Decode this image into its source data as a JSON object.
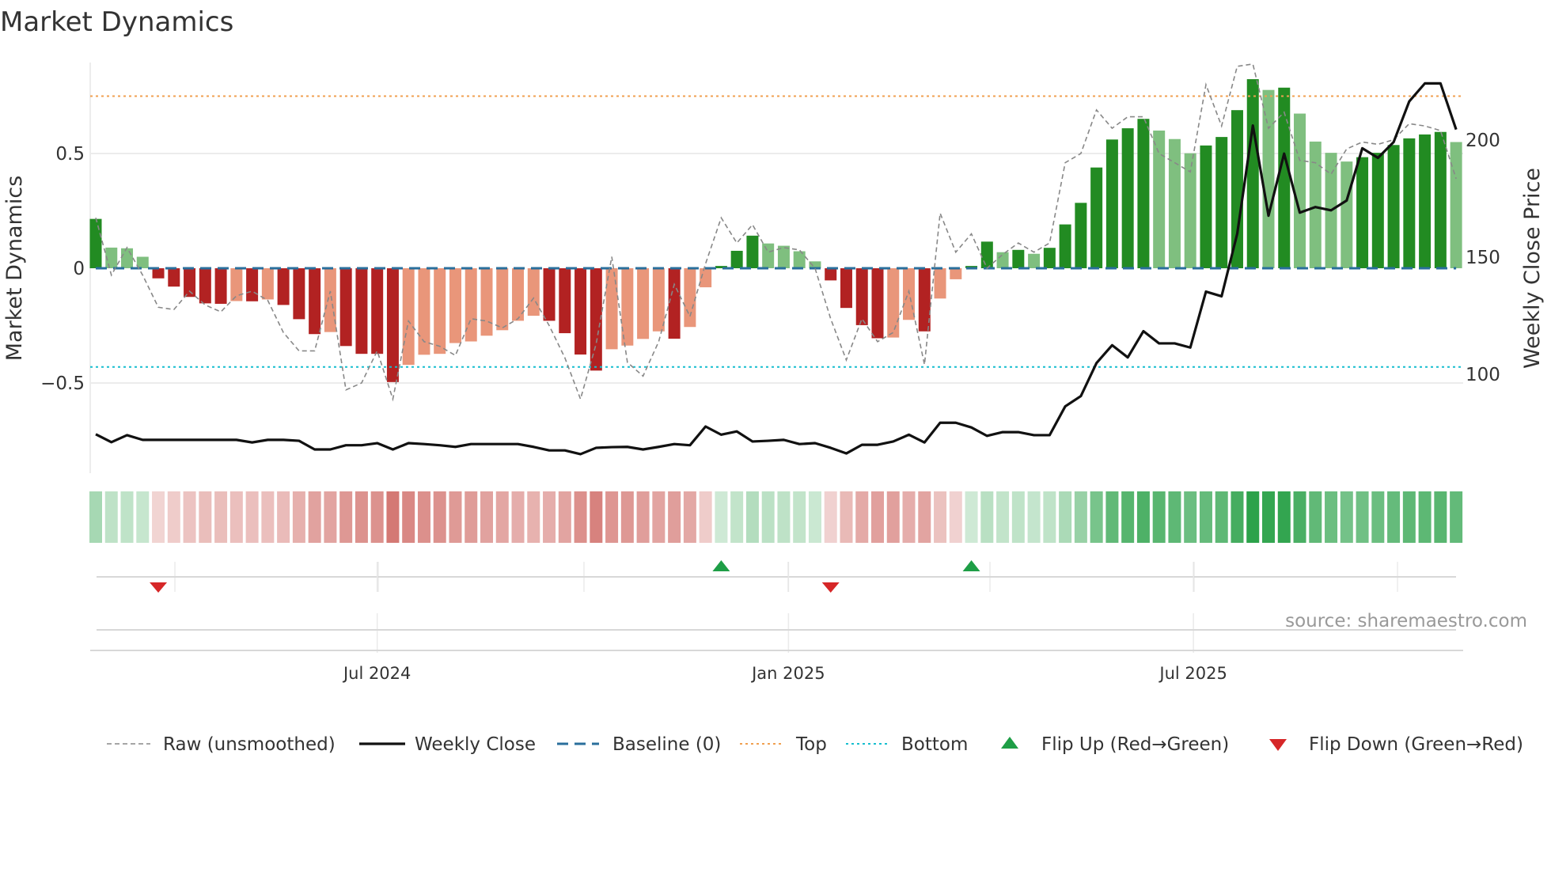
{
  "chart_data": {
    "type": "bar",
    "title": "Market Dynamics",
    "ylabel": "Market Dynamics",
    "y2label": "Weekly Close Price",
    "ylim": [
      -0.92,
      0.9
    ],
    "y2lim": [
      55,
      230
    ],
    "yticks": [
      {
        "value": 0.5,
        "label": "0.5"
      },
      {
        "value": 0,
        "label": "0"
      },
      {
        "value": -0.5,
        "label": "−0.5"
      }
    ],
    "y2ticks": [
      {
        "value": 200,
        "label": "200"
      },
      {
        "value": 150,
        "label": "150"
      },
      {
        "value": 100,
        "label": "100"
      }
    ],
    "xticks": [
      {
        "week": 18,
        "label": "Jul 2024"
      },
      {
        "week": 44.3,
        "label": "Jan 2025"
      },
      {
        "week": 70.2,
        "label": "Jul 2025"
      }
    ],
    "grid": true,
    "top_level": 0.75,
    "bottom_level": -0.43,
    "baseline": 0,
    "values": [
      0.215,
      0.09,
      0.087,
      0.05,
      -0.044,
      -0.08,
      -0.125,
      -0.153,
      -0.155,
      -0.143,
      -0.144,
      -0.136,
      -0.16,
      -0.222,
      -0.287,
      -0.278,
      -0.339,
      -0.373,
      -0.373,
      -0.496,
      -0.421,
      -0.377,
      -0.373,
      -0.326,
      -0.319,
      -0.294,
      -0.27,
      -0.229,
      -0.207,
      -0.229,
      -0.283,
      -0.376,
      -0.446,
      -0.353,
      -0.337,
      -0.308,
      -0.275,
      -0.307,
      -0.256,
      -0.083,
      0.01,
      0.076,
      0.142,
      0.108,
      0.098,
      0.074,
      0.03,
      -0.053,
      -0.173,
      -0.248,
      -0.305,
      -0.302,
      -0.225,
      -0.275,
      -0.132,
      -0.048,
      0.01,
      0.116,
      0.07,
      0.08,
      0.063,
      0.089,
      0.191,
      0.285,
      0.439,
      0.561,
      0.61,
      0.651,
      0.6,
      0.563,
      0.501,
      0.535,
      0.572,
      0.689,
      0.824,
      0.777,
      0.787,
      0.674,
      0.552,
      0.503,
      0.465,
      0.484,
      0.503,
      0.537,
      0.566,
      0.583,
      0.594,
      0.55
    ],
    "strength": [
      1,
      0,
      0,
      0,
      1,
      1,
      1,
      1,
      1,
      0,
      1,
      0,
      1,
      1,
      1,
      0,
      1,
      1,
      1,
      1,
      0,
      0,
      0,
      0,
      0,
      0,
      0,
      0,
      0,
      1,
      1,
      1,
      1,
      0,
      0,
      0,
      0,
      1,
      0,
      0,
      1,
      1,
      1,
      0,
      0,
      0,
      0,
      1,
      1,
      1,
      1,
      0,
      0,
      1,
      0,
      0,
      1,
      1,
      0,
      1,
      0,
      1,
      1,
      1,
      1,
      1,
      1,
      1,
      0,
      0,
      0,
      1,
      1,
      1,
      1,
      0,
      1,
      0,
      0,
      0,
      0,
      1,
      1,
      1,
      1,
      1,
      1,
      0
    ],
    "raw": [
      0.22,
      -0.03,
      0.09,
      -0.03,
      -0.17,
      -0.18,
      -0.1,
      -0.16,
      -0.19,
      -0.12,
      -0.1,
      -0.14,
      -0.28,
      -0.36,
      -0.36,
      -0.1,
      -0.53,
      -0.5,
      -0.36,
      -0.57,
      -0.23,
      -0.32,
      -0.34,
      -0.38,
      -0.22,
      -0.23,
      -0.26,
      -0.22,
      -0.13,
      -0.25,
      -0.39,
      -0.57,
      -0.33,
      0.05,
      -0.41,
      -0.47,
      -0.32,
      -0.07,
      -0.21,
      0.02,
      0.22,
      0.11,
      0.19,
      0.07,
      0.09,
      0.08,
      0,
      -0.22,
      -0.4,
      -0.22,
      -0.32,
      -0.28,
      -0.1,
      -0.42,
      0.24,
      0.07,
      0.15,
      0,
      0.06,
      0.11,
      0.07,
      0.11,
      0.46,
      0.5,
      0.69,
      0.61,
      0.66,
      0.66,
      0.5,
      0.46,
      0.42,
      0.8,
      0.62,
      0.88,
      0.89,
      0.61,
      0.68,
      0.47,
      0.46,
      0.41,
      0.52,
      0.55,
      0.54,
      0.56,
      0.63,
      0.62,
      0.6,
      0.39
    ],
    "close": [
      74.4,
      71.0,
      74.0,
      72.0,
      72.0,
      72.0,
      72.0,
      72.0,
      72.0,
      72.0,
      70.9,
      72.0,
      72.0,
      71.6,
      67.9,
      67.9,
      69.7,
      69.7,
      70.6,
      67.9,
      70.6,
      70.2,
      69.7,
      69.0,
      70.2,
      70.2,
      70.2,
      70.2,
      69.0,
      67.5,
      67.5,
      65.9,
      68.6,
      68.9,
      69.0,
      67.9,
      69.0,
      70.2,
      69.7,
      77.7,
      74.2,
      75.6,
      71.3,
      71.6,
      72.0,
      70.2,
      70.6,
      68.6,
      66.2,
      69.9,
      69.9,
      71.3,
      74.2,
      70.9,
      79.3,
      79.3,
      77.3,
      73.7,
      75.3,
      75.3,
      74.0,
      74.0,
      86.3,
      90.7,
      104.8,
      112.4,
      107.2,
      118.4,
      113.2,
      113.2,
      111.4,
      135.3,
      133.3,
      160.0,
      206.2,
      167.7,
      194.2,
      169.0,
      171.4,
      170.0,
      174.2,
      196.5,
      192.4,
      199.1,
      216.5,
      224.2,
      224.2,
      204.5
    ],
    "flip_up_weeks": [
      40,
      56
    ],
    "flip_down_weeks": [
      4,
      47
    ],
    "legend": {
      "position": "bottom",
      "items": [
        {
          "key": "raw",
          "label": "Raw (unsmoothed)"
        },
        {
          "key": "close",
          "label": "Weekly Close"
        },
        {
          "key": "baseline",
          "label": "Baseline (0)"
        },
        {
          "key": "top",
          "label": "Top"
        },
        {
          "key": "bottom",
          "label": "Bottom"
        },
        {
          "key": "flip_up",
          "label": "Flip Up (Red→Green)"
        },
        {
          "key": "flip_down",
          "label": "Flip Down (Green→Red)"
        }
      ]
    },
    "annotation": "source: sharemaestro.com"
  },
  "colors": {
    "strong_green": "#228b22",
    "weak_green": "#7fbf7f",
    "strong_red": "#b22222",
    "weak_red": "#e9967a",
    "top": "#f0a050",
    "bottom": "#17becf",
    "baseline": "#2a6f9c",
    "raw": "#888888",
    "close": "#111111",
    "flip_up": "#1e9e46",
    "flip_down": "#d62728"
  }
}
